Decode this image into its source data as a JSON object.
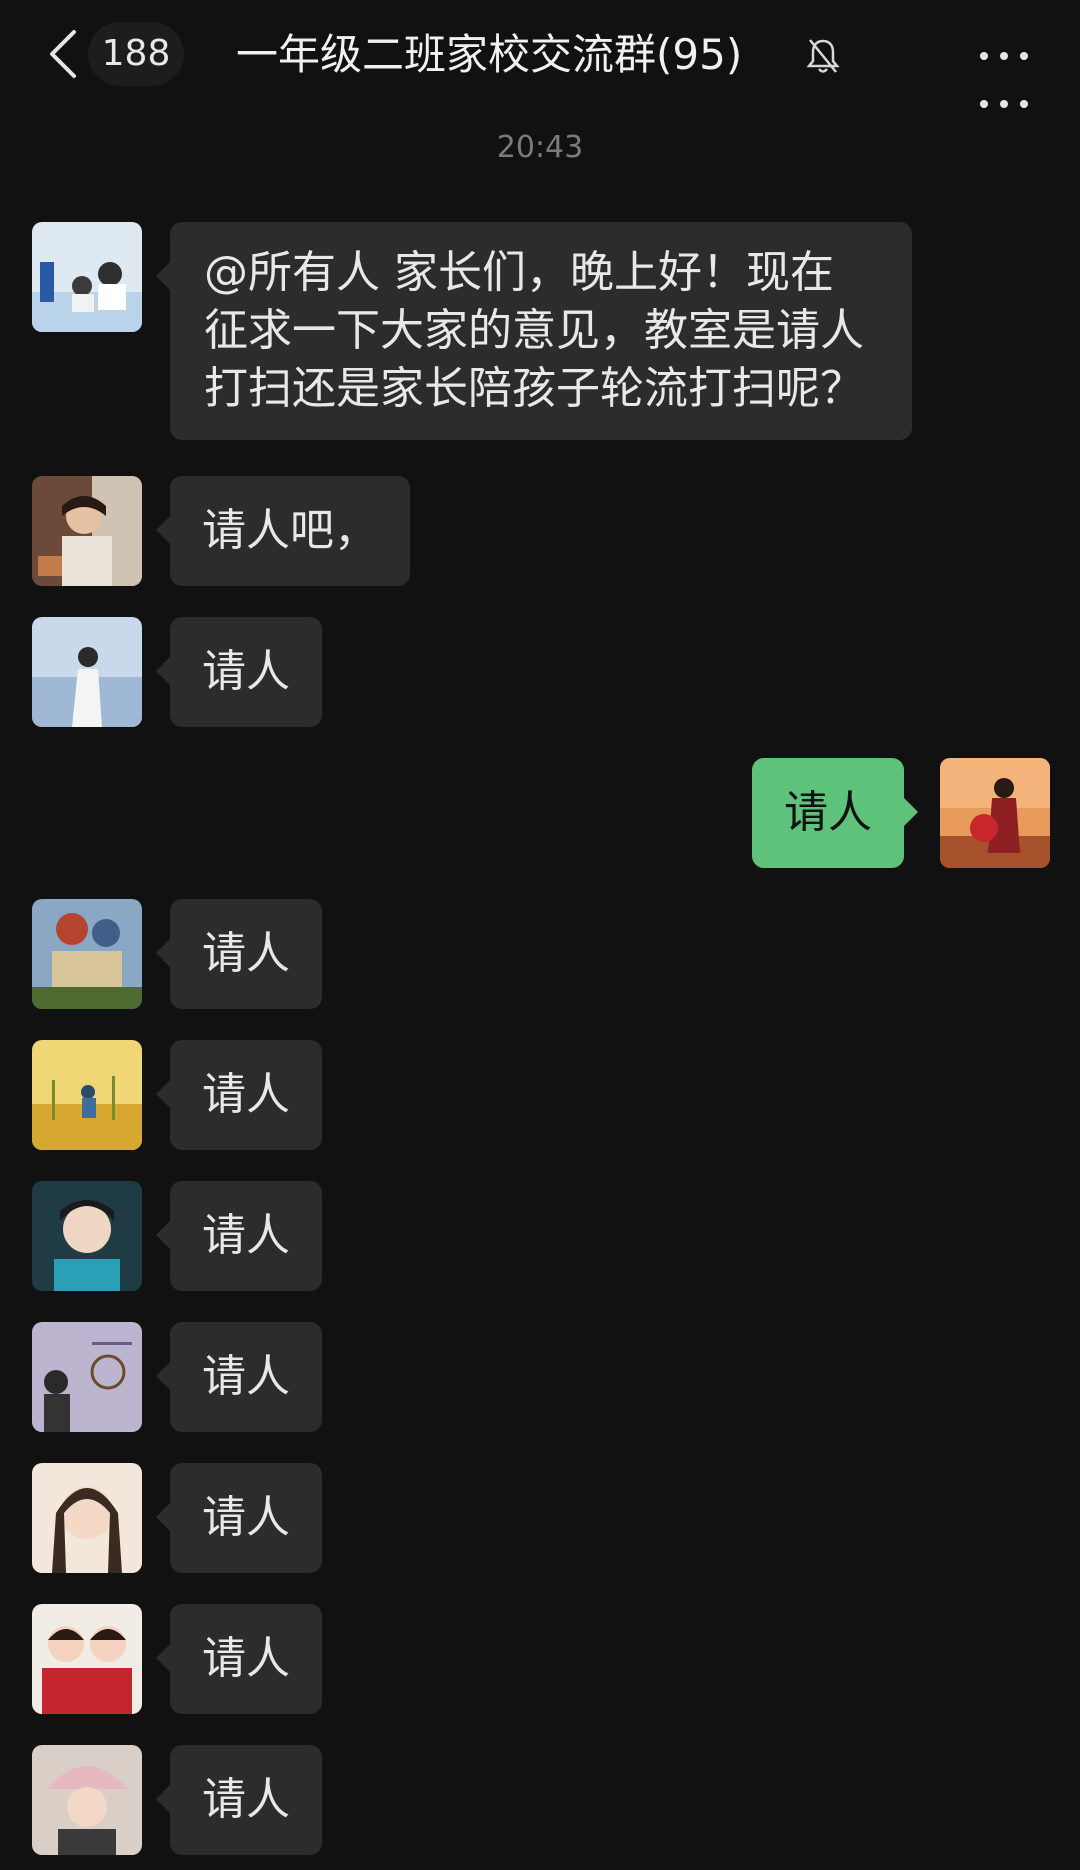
{
  "header": {
    "unread_count": "188",
    "title": "一年级二班家校交流群(95)",
    "icons": {
      "back": "chevron-left-icon",
      "mute": "bell-off-icon",
      "more": "more-dots-icon"
    }
  },
  "timestamp": "20:43",
  "messages": [
    {
      "side": "left",
      "lines": [
        "@所有人  家长们，晚上好！现在",
        "征求一下大家的意见，教室是请人",
        "打扫还是家长陪孩子轮流打扫呢？"
      ]
    },
    {
      "side": "left",
      "text": "请人吧，"
    },
    {
      "side": "left",
      "text": "请人"
    },
    {
      "side": "right",
      "text": "请人"
    },
    {
      "side": "left",
      "text": "请人"
    },
    {
      "side": "left",
      "text": "请人"
    },
    {
      "side": "left",
      "text": "请人"
    },
    {
      "side": "left",
      "text": "请人"
    },
    {
      "side": "left",
      "text": "请人"
    },
    {
      "side": "left",
      "text": "请人"
    },
    {
      "side": "left",
      "text": "请人"
    }
  ],
  "colors": {
    "background": "#111111",
    "incoming_bubble": "#2c2c2c",
    "outgoing_bubble": "#5fc27a"
  }
}
